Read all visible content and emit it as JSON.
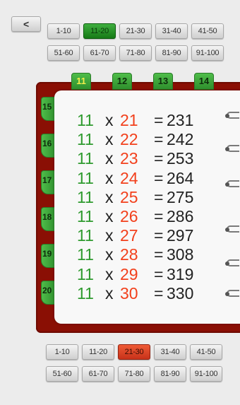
{
  "back_label": "<",
  "top_ranges": [
    "1-10",
    "11-20",
    "21-30",
    "31-40",
    "41-50",
    "51-60",
    "61-70",
    "71-80",
    "81-90",
    "91-100"
  ],
  "top_selected": "11-20",
  "bottom_ranges": [
    "1-10",
    "11-20",
    "21-30",
    "31-40",
    "41-50",
    "51-60",
    "61-70",
    "71-80",
    "81-90",
    "91-100"
  ],
  "bottom_selected": "21-30",
  "top_tabs": [
    "11",
    "12",
    "13",
    "14"
  ],
  "active_tab": "11",
  "side_tabs": [
    "15",
    "16",
    "17",
    "18",
    "19",
    "20"
  ],
  "equations": [
    {
      "a": "11",
      "op": "x",
      "b": "21",
      "eq": "=",
      "r": "231"
    },
    {
      "a": "11",
      "op": "x",
      "b": "22",
      "eq": "=",
      "r": "242"
    },
    {
      "a": "11",
      "op": "x",
      "b": "23",
      "eq": "=",
      "r": "253"
    },
    {
      "a": "11",
      "op": "x",
      "b": "24",
      "eq": "=",
      "r": "264"
    },
    {
      "a": "11",
      "op": "x",
      "b": "25",
      "eq": "=",
      "r": "275"
    },
    {
      "a": "11",
      "op": "x",
      "b": "26",
      "eq": "=",
      "r": "286"
    },
    {
      "a": "11",
      "op": "x",
      "b": "27",
      "eq": "=",
      "r": "297"
    },
    {
      "a": "11",
      "op": "x",
      "b": "28",
      "eq": "=",
      "r": "308"
    },
    {
      "a": "11",
      "op": "x",
      "b": "29",
      "eq": "=",
      "r": "319"
    },
    {
      "a": "11",
      "op": "x",
      "b": "30",
      "eq": "=",
      "r": "330"
    }
  ],
  "colors": {
    "multiplicand": "#2e9a2e",
    "multiplier": "#f2401c",
    "cover": "#8a0f04",
    "tab": "#3fa83b",
    "active_tab_text": "#f1ee4b",
    "selected_top": "#1f8a1f",
    "selected_bottom": "#e04a28"
  }
}
